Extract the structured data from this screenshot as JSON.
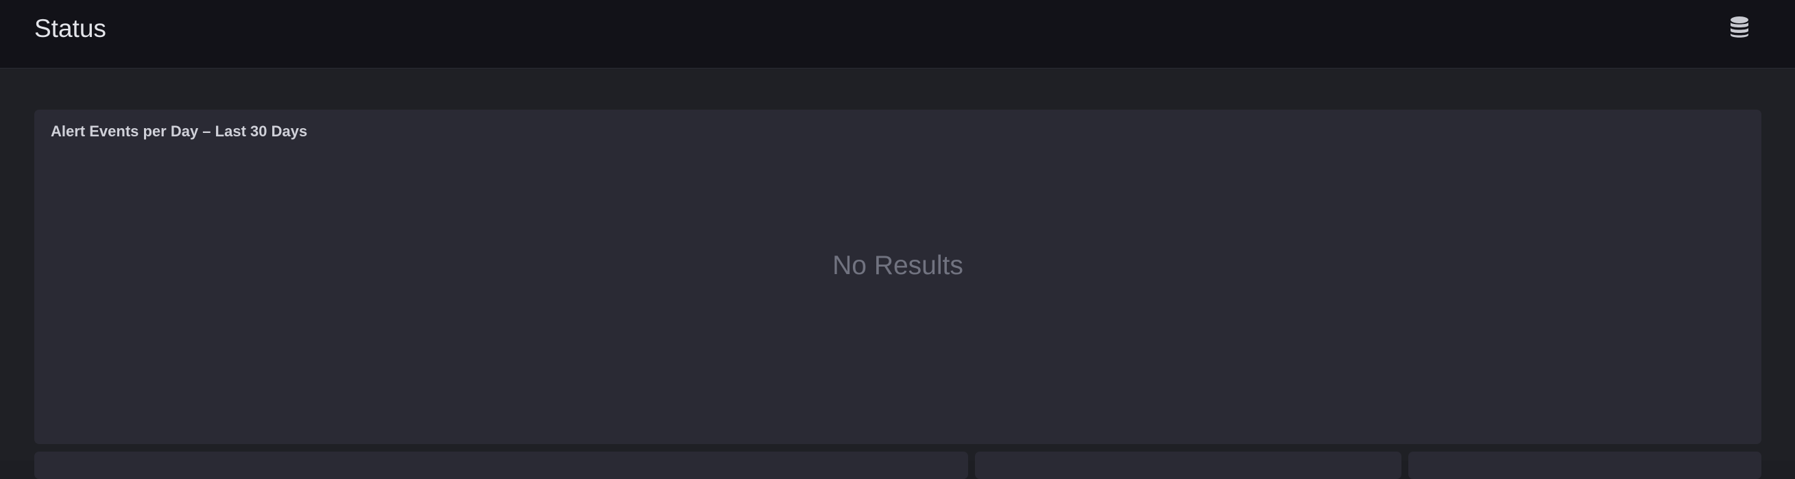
{
  "header": {
    "title": "Status",
    "icon": "database-icon"
  },
  "panels": {
    "alert_events": {
      "title": "Alert Events per Day – Last 30 Days",
      "empty_message": "No Results"
    }
  },
  "colors": {
    "topbar_bg": "#121218",
    "page_bg": "#1f2025",
    "panel_bg": "#2a2a34",
    "title_text": "#e4e5ea",
    "panel_title_text": "#d0d1d9",
    "muted_text": "#717380"
  }
}
